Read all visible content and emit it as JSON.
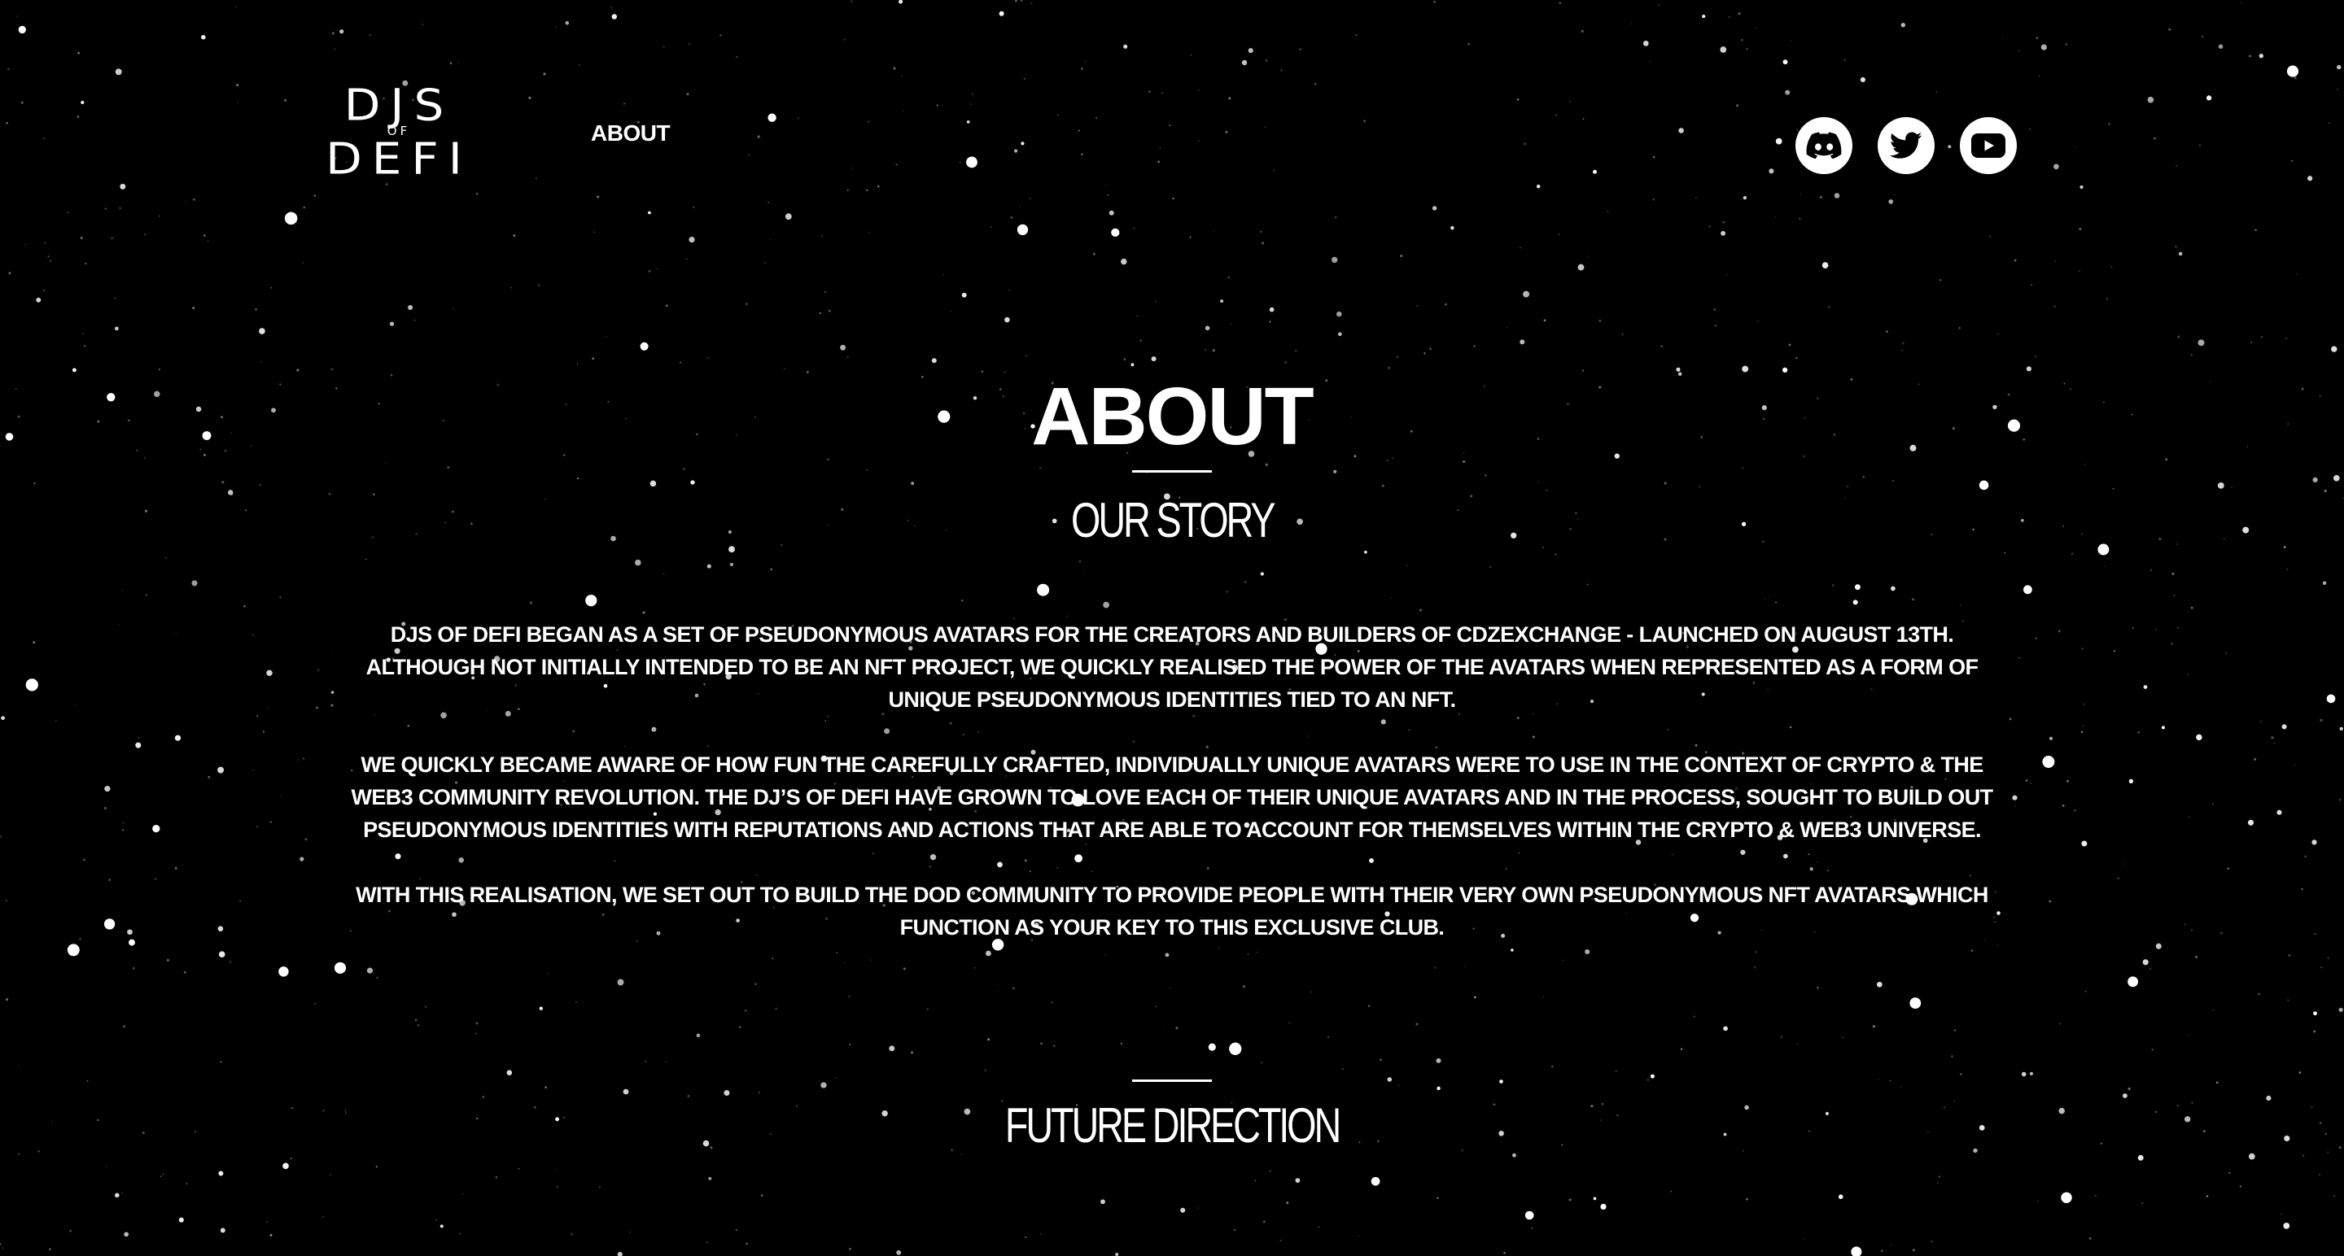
{
  "site": {
    "logo_top": "DJS",
    "logo_mid": "OF",
    "logo_bottom": "DEFI",
    "nav": {
      "about_label": "ABOUT"
    },
    "social": [
      {
        "name": "discord",
        "icon": "discord-icon"
      },
      {
        "name": "twitter",
        "icon": "twitter-icon"
      },
      {
        "name": "youtube",
        "icon": "youtube-icon"
      }
    ]
  },
  "main": {
    "title": "ABOUT",
    "story_heading": "OUR STORY",
    "paragraphs": [
      "DJS OF DEFI BEGAN AS A SET OF PSEUDONYMOUS AVATARS FOR THE CREATORS AND BUILDERS OF CDZEXCHANGE - LAUNCHED ON AUGUST 13TH. ALTHOUGH NOT INITIALLY INTENDED TO BE AN NFT PROJECT, WE QUICKLY REALISED THE POWER OF THE AVATARS WHEN REPRESENTED AS A FORM OF UNIQUE PSEUDONYMOUS IDENTITIES TIED TO AN NFT.",
      "WE QUICKLY BECAME AWARE OF HOW FUN THE CAREFULLY CRAFTED, INDIVIDUALLY UNIQUE AVATARS WERE TO USE IN THE CONTEXT OF CRYPTO & THE WEB3 COMMUNITY REVOLUTION. THE DJ’S OF DEFI HAVE GROWN TO LOVE EACH OF THEIR UNIQUE AVATARS AND IN THE PROCESS, SOUGHT TO BUILD OUT PSEUDONYMOUS IDENTITIES WITH REPUTATIONS AND ACTIONS THAT ARE ABLE TO ACCOUNT FOR THEMSELVES WITHIN THE CRYPTO & WEB3 UNIVERSE.",
      "WITH THIS REALISATION, WE SET OUT TO BUILD THE DOD COMMUNITY TO PROVIDE PEOPLE WITH THEIR VERY OWN PSEUDONYMOUS NFT AVATARS WHICH FUNCTION AS YOUR KEY TO THIS EXCLUSIVE CLUB."
    ],
    "future_heading": "FUTURE DIRECTION"
  },
  "colors": {
    "background": "#000000",
    "text": "#ffffff",
    "icon_fill": "#ffffff",
    "icon_glyph": "#000000"
  }
}
